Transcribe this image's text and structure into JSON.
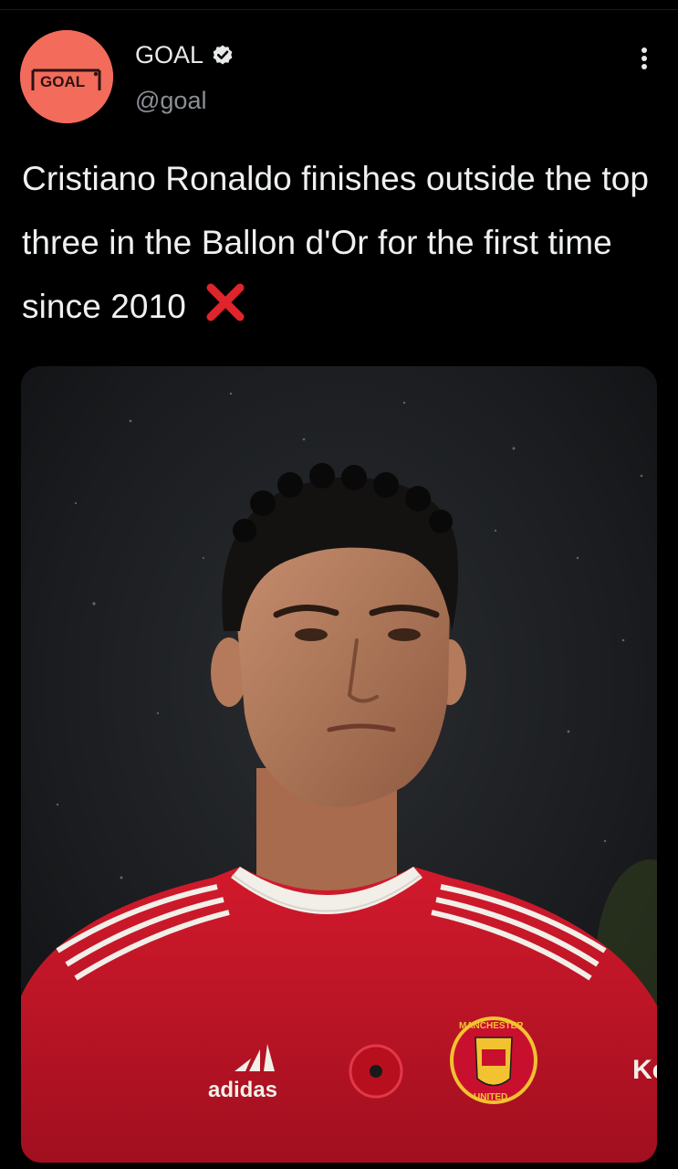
{
  "tweet": {
    "author": {
      "display_name": "GOAL",
      "handle": "@goal",
      "verified": true,
      "avatar_text": "GOAL",
      "avatar_color": "#f26b5b"
    },
    "text": "Cristiano Ronaldo finishes outside the top three in the Ballon d'Or for the first time since 2010",
    "emoji_icon": "cross-mark-icon",
    "menu_icon": "more-vertical-icon",
    "media": {
      "kit_brand_text": "adidas",
      "crest_top_text": "MANCHESTER",
      "crest_bottom_text": "UNITED",
      "sleeve_text": "Ko"
    }
  },
  "colors": {
    "background": "#000000",
    "primary_text": "#e7e9ea",
    "secondary_text": "#8b8f94",
    "cross_red": "#e0242b",
    "shirt_red": "#c8102e"
  }
}
